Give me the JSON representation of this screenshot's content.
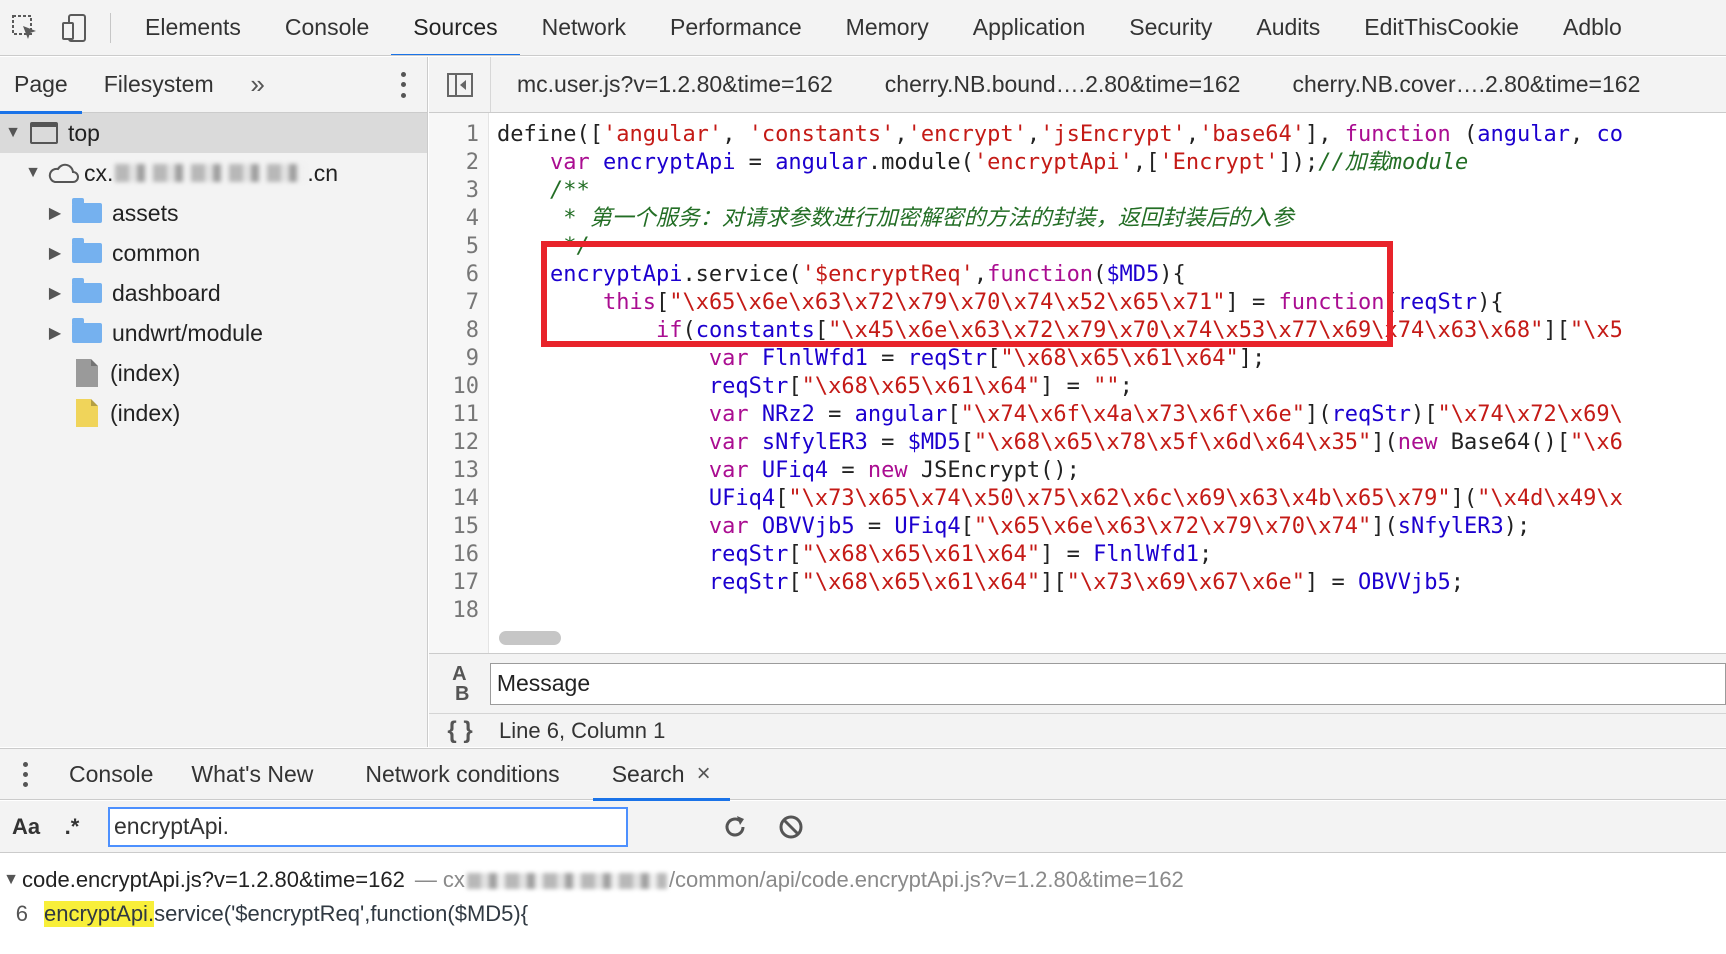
{
  "toolbar": {
    "inspect_icon": "inspect-element-icon",
    "device_icon": "device-toggle-icon",
    "tabs": [
      "Elements",
      "Console",
      "Sources",
      "Network",
      "Performance",
      "Memory",
      "Application",
      "Security",
      "Audits",
      "EditThisCookie",
      "Adblo"
    ],
    "active_tab": "Sources"
  },
  "navigator": {
    "tabs": [
      "Page",
      "Filesystem"
    ],
    "more": "»",
    "tree": {
      "top": "top",
      "domain_prefix": "cx.",
      "domain_suffix": ".cn",
      "folders": [
        "assets",
        "common",
        "dashboard",
        "undwrt/module"
      ],
      "files": [
        "(index)",
        "(index)"
      ]
    }
  },
  "editor": {
    "tabs": [
      "mc.user.js?v=1.2.80&time=162",
      "cherry.NB.bound….2.80&time=162",
      "cherry.NB.cover….2.80&time=162"
    ],
    "line_numbers": [
      "1",
      "2",
      "3",
      "4",
      "5",
      "6",
      "7",
      "8",
      "9",
      "10",
      "11",
      "12",
      "13",
      "14",
      "15",
      "16",
      "17",
      "18"
    ],
    "code": {
      "l1a": "define([",
      "l1b": "'angular'",
      "l1c": ", ",
      "l1d": "'constants'",
      "l1e": ",",
      "l1f": "'encrypt'",
      "l1g": ",",
      "l1h": "'jsEncrypt'",
      "l1i": ",",
      "l1j": "'base64'",
      "l1k": "], ",
      "l1l": "function",
      "l1m": " (",
      "l1n": "angular",
      "l1o": ", ",
      "l1p": "co",
      "l2a": "    ",
      "l2b": "var",
      "l2c": " ",
      "l2d": "encryptApi",
      "l2e": " = ",
      "l2f": "angular",
      "l2g": ".module(",
      "l2h": "'encryptApi'",
      "l2i": ",[",
      "l2j": "'Encrypt'",
      "l2k": "]);",
      "l2l": "//加载module",
      "l3": "    /**",
      "l4": "     * 第一个服务：对请求参数进行加密解密的方法的封装，返回封装后的入参",
      "l5": "     */",
      "l6a": "    ",
      "l6b": "encryptApi",
      "l6c": ".service(",
      "l6d": "'$encryptReq'",
      "l6e": ",",
      "l6f": "function",
      "l6g": "(",
      "l6h": "$MD5",
      "l6i": "){",
      "l7a": "        ",
      "l7b": "this",
      "l7c": "[",
      "l7d": "\"\\x65\\x6e\\x63\\x72\\x79\\x70\\x74\\x52\\x65\\x71\"",
      "l7e": "] = ",
      "l7f": "function",
      "l7g": "(",
      "l7h": "reqStr",
      "l7i": "){",
      "l8a": "            ",
      "l8b": "if",
      "l8c": "(",
      "l8d": "constants",
      "l8e": "[",
      "l8f": "\"\\x45\\x6e\\x63\\x72\\x79\\x70\\x74\\x53\\x77\\x69\\x74\\x63\\x68\"",
      "l8g": "][",
      "l8h": "\"\\x5",
      "l9a": "                ",
      "l9b": "var",
      "l9c": " ",
      "l9d": "FlnlWfd1",
      "l9e": " = ",
      "l9f": "reqStr",
      "l9g": "[",
      "l9h": "\"\\x68\\x65\\x61\\x64\"",
      "l9i": "];",
      "l10a": "                ",
      "l10b": "reqStr",
      "l10c": "[",
      "l10d": "\"\\x68\\x65\\x61\\x64\"",
      "l10e": "] = ",
      "l10f": "\"\"",
      "l10g": ";",
      "l11a": "                ",
      "l11b": "var",
      "l11c": " ",
      "l11d": "NRz2",
      "l11e": " = ",
      "l11f": "angular",
      "l11g": "[",
      "l11h": "\"\\x74\\x6f\\x4a\\x73\\x6f\\x6e\"",
      "l11i": "](",
      "l11j": "reqStr",
      "l11k": ")[",
      "l11l": "\"\\x74\\x72\\x69\\",
      "l12a": "                ",
      "l12b": "var",
      "l12c": " ",
      "l12d": "sNfylER3",
      "l12e": " = ",
      "l12f": "$MD5",
      "l12g": "[",
      "l12h": "\"\\x68\\x65\\x78\\x5f\\x6d\\x64\\x35\"",
      "l12i": "](",
      "l12j": "new",
      "l12k": " Base64()[",
      "l12l": "\"\\x6",
      "l13a": "                ",
      "l13b": "var",
      "l13c": " ",
      "l13d": "UFiq4",
      "l13e": " = ",
      "l13f": "new",
      "l13g": " JSEncrypt();",
      "l14a": "                ",
      "l14b": "UFiq4",
      "l14c": "[",
      "l14d": "\"\\x73\\x65\\x74\\x50\\x75\\x62\\x6c\\x69\\x63\\x4b\\x65\\x79\"",
      "l14e": "](",
      "l14f": "\"\\x4d\\x49\\x",
      "l15a": "                ",
      "l15b": "var",
      "l15c": " ",
      "l15d": "OBVVjb5",
      "l15e": " = ",
      "l15f": "UFiq4",
      "l15g": "[",
      "l15h": "\"\\x65\\x6e\\x63\\x72\\x79\\x70\\x74\"",
      "l15i": "](",
      "l15j": "sNfylER3",
      "l15k": ");",
      "l16a": "                ",
      "l16b": "reqStr",
      "l16c": "[",
      "l16d": "\"\\x68\\x65\\x61\\x64\"",
      "l16e": "] = ",
      "l16f": "FlnlWfd1",
      "l16g": ";",
      "l17a": "                ",
      "l17b": "reqStr",
      "l17c": "[",
      "l17d": "\"\\x68\\x65\\x61\\x64\"",
      "l17e": "][",
      "l17f": "\"\\x73\\x69\\x67\\x6e\"",
      "l17g": "] = ",
      "l17h": "OBVVjb5",
      "l17i": ";"
    },
    "message_placeholder": "Message",
    "status": "Line 6, Column 1"
  },
  "drawer": {
    "tabs": [
      "Console",
      "What's New",
      "Network conditions",
      "Search"
    ],
    "active_tab": "Search",
    "close": "×",
    "search": {
      "case_label": "Aa",
      "regex_label": ".*",
      "query": "encryptApi."
    },
    "results": {
      "file": "code.encryptApi.js?v=1.2.80&time=162",
      "path_prefix": "— cx",
      "path_suffix": "/common/api/code.encryptApi.js?v=1.2.80&time=162",
      "line_number": "6",
      "match": "encryptApi.",
      "rest": "service('$encryptReq',function($MD5){"
    }
  },
  "colors": {
    "accent": "#1a73e8",
    "highlight_box": "#e8232a",
    "match_highlight": "#f8ef3a",
    "keyword": "#aa0d91",
    "string": "#c41a16",
    "variable": "#1c00cf",
    "comment": "#236e25"
  }
}
